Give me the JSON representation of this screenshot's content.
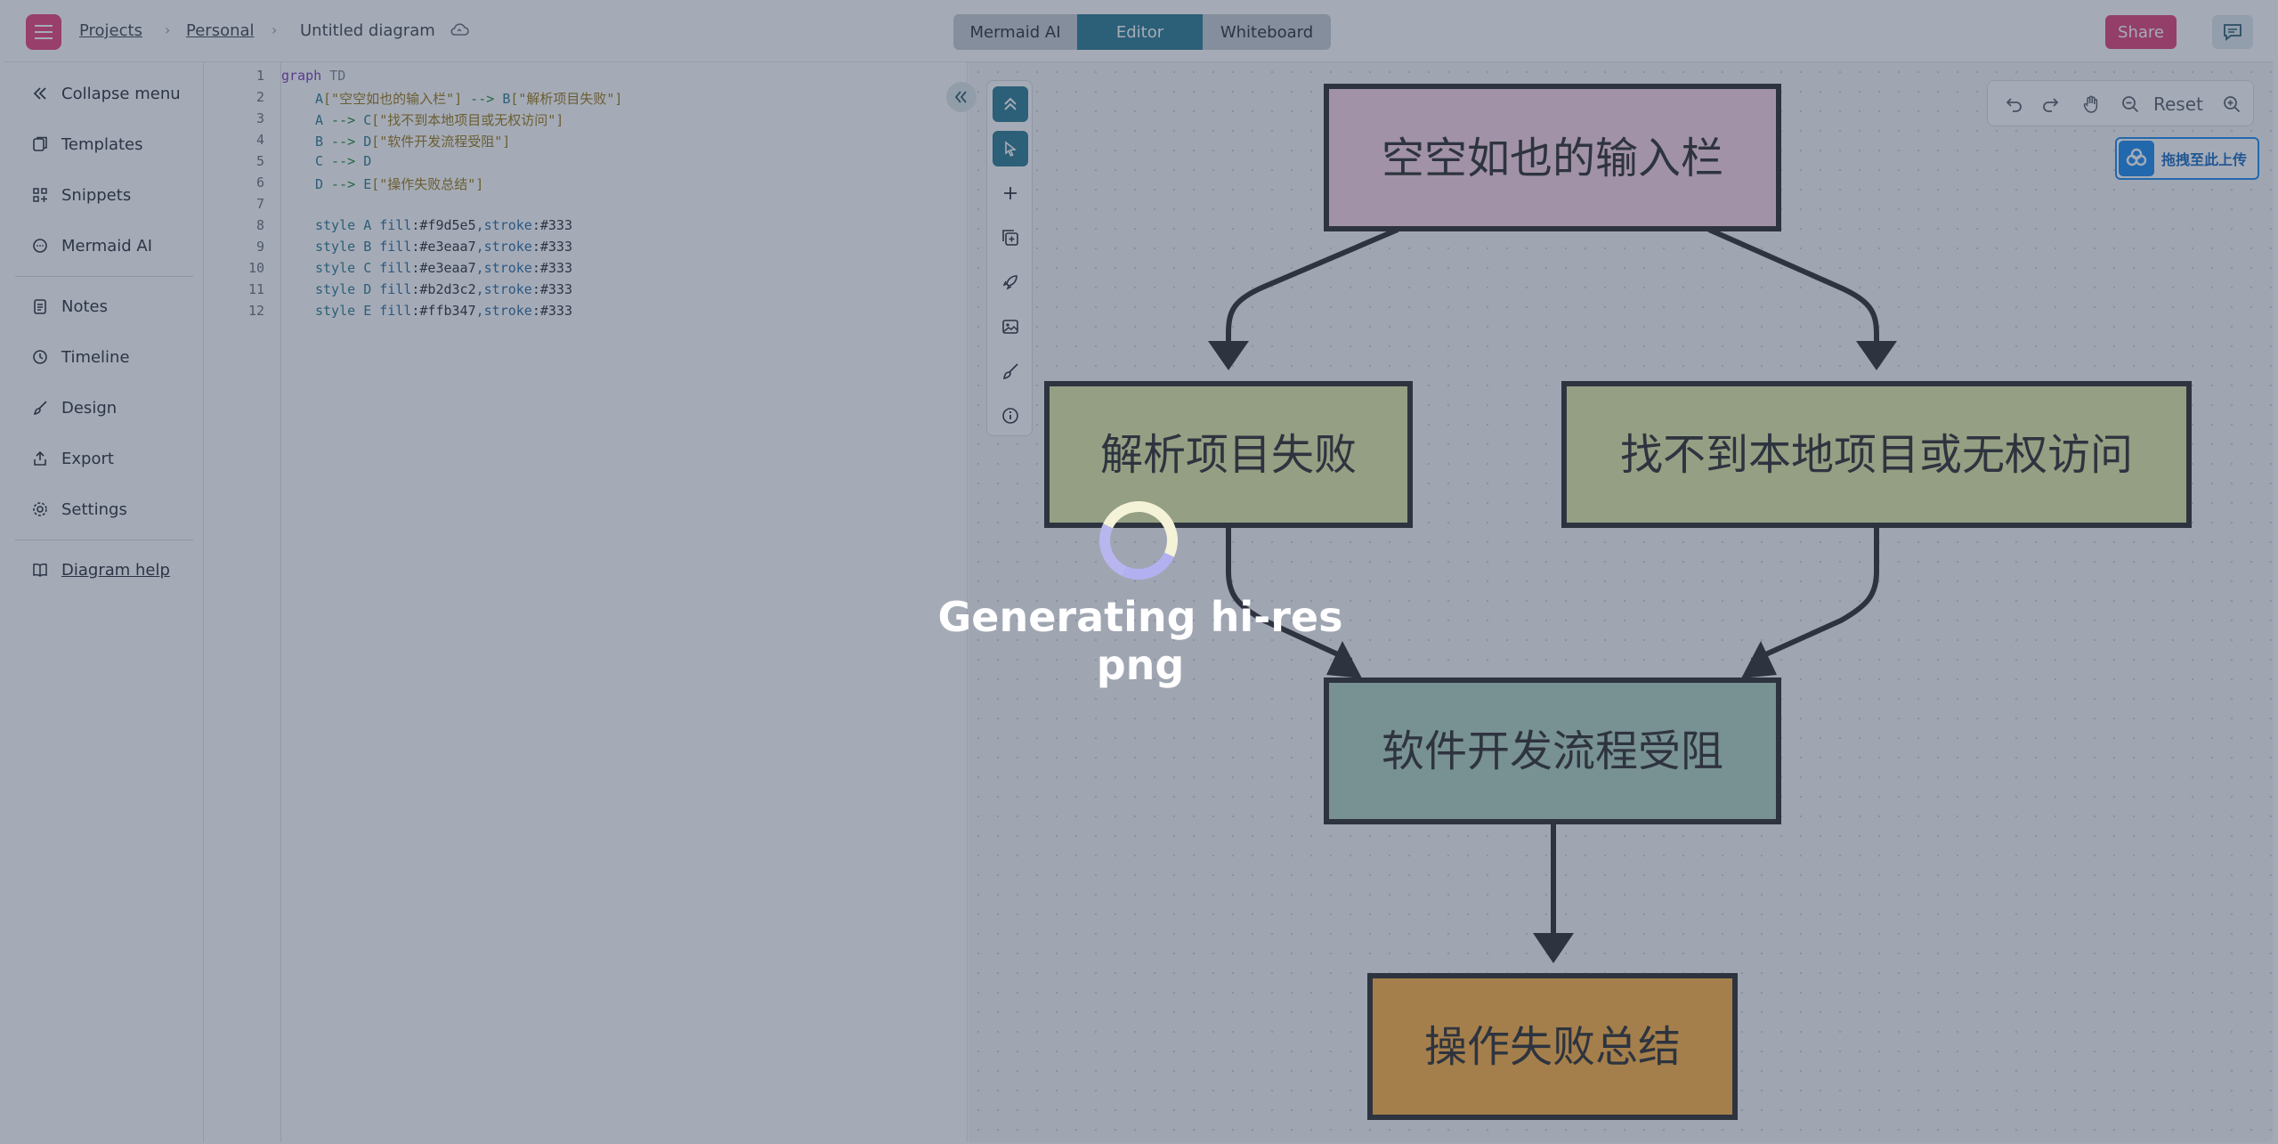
{
  "breadcrumb": {
    "projects": "Projects",
    "personal": "Personal",
    "diagram": "Untitled diagram",
    "separator": "›"
  },
  "modes": [
    "Mermaid AI",
    "Editor",
    "Whiteboard"
  ],
  "share_label": "Share",
  "sidebar": {
    "items": [
      {
        "label": "Collapse menu",
        "icon": "double-chevron-left-icon"
      },
      {
        "label": "Templates",
        "icon": "templates-icon"
      },
      {
        "label": "Snippets",
        "icon": "snippets-icon"
      },
      {
        "label": "Mermaid AI",
        "icon": "chat-bubble-icon"
      },
      {
        "label": "Notes",
        "icon": "notes-icon"
      },
      {
        "label": "Timeline",
        "icon": "clock-icon"
      },
      {
        "label": "Design",
        "icon": "brush-icon"
      },
      {
        "label": "Export",
        "icon": "export-icon"
      },
      {
        "label": "Settings",
        "icon": "gear-icon"
      },
      {
        "label": "Diagram help",
        "icon": "book-icon"
      }
    ]
  },
  "code": {
    "line_numbers": [
      "1",
      "2",
      "3",
      "4",
      "5",
      "6",
      "7",
      "8",
      "9",
      "10",
      "11",
      "12"
    ],
    "l1": {
      "kw": "graph",
      "dir": " TD"
    },
    "l2": {
      "a": "A",
      "s1": "[\"空空如也的输入栏\"]",
      "arrow": " --> ",
      "b": "B",
      "s2": "[\"解析项目失败\"]"
    },
    "l3": {
      "a": "A",
      "arrow": " --> ",
      "b": "C",
      "s2": "[\"找不到本地项目或无权访问\"]"
    },
    "l4": {
      "a": "B",
      "arrow": " --> ",
      "b": "D",
      "s2": "[\"软件开发流程受阻\"]"
    },
    "l5": {
      "a": "C",
      "arrow": " --> ",
      "b": "D"
    },
    "l6": {
      "a": "D",
      "arrow": " --> ",
      "b": "E",
      "s2": "[\"操作失败总结\"]"
    },
    "styles": [
      {
        "kw": "style ",
        "id": "A",
        "fill": " fill",
        "fv": ":#f9d5e5",
        "stroke": ",stroke",
        "sv": ":#333"
      },
      {
        "kw": "style ",
        "id": "B",
        "fill": " fill",
        "fv": ":#e3eaa7",
        "stroke": ",stroke",
        "sv": ":#333"
      },
      {
        "kw": "style ",
        "id": "C",
        "fill": " fill",
        "fv": ":#e3eaa7",
        "stroke": ",stroke",
        "sv": ":#333"
      },
      {
        "kw": "style ",
        "id": "D",
        "fill": " fill",
        "fv": ":#b2d3c2",
        "stroke": ",stroke",
        "sv": ":#333"
      },
      {
        "kw": "style ",
        "id": "E",
        "fill": " fill",
        "fv": ":#ffb347",
        "stroke": ",stroke",
        "sv": ":#333"
      }
    ]
  },
  "diagram": {
    "nodes": {
      "A": {
        "label": "空空如也的输入栏",
        "fill": "#f9d5e5"
      },
      "B": {
        "label": "解析项目失败",
        "fill": "#e3eaa7"
      },
      "C": {
        "label": "找不到本地项目或无权访问",
        "fill": "#e3eaa7"
      },
      "D": {
        "label": "软件开发流程受阻",
        "fill": "#b2d3c2"
      },
      "E": {
        "label": "操作失败总结",
        "fill": "#ffb347"
      }
    },
    "stroke": "#333333"
  },
  "view_controls": {
    "reset_label": "Reset"
  },
  "upload_badge": {
    "label": "拖拽至此上传"
  },
  "overlay": {
    "message": "Generating hi-res png"
  },
  "colors": {
    "accent_pink": "#e0457c",
    "teal": "#2f7d95"
  }
}
